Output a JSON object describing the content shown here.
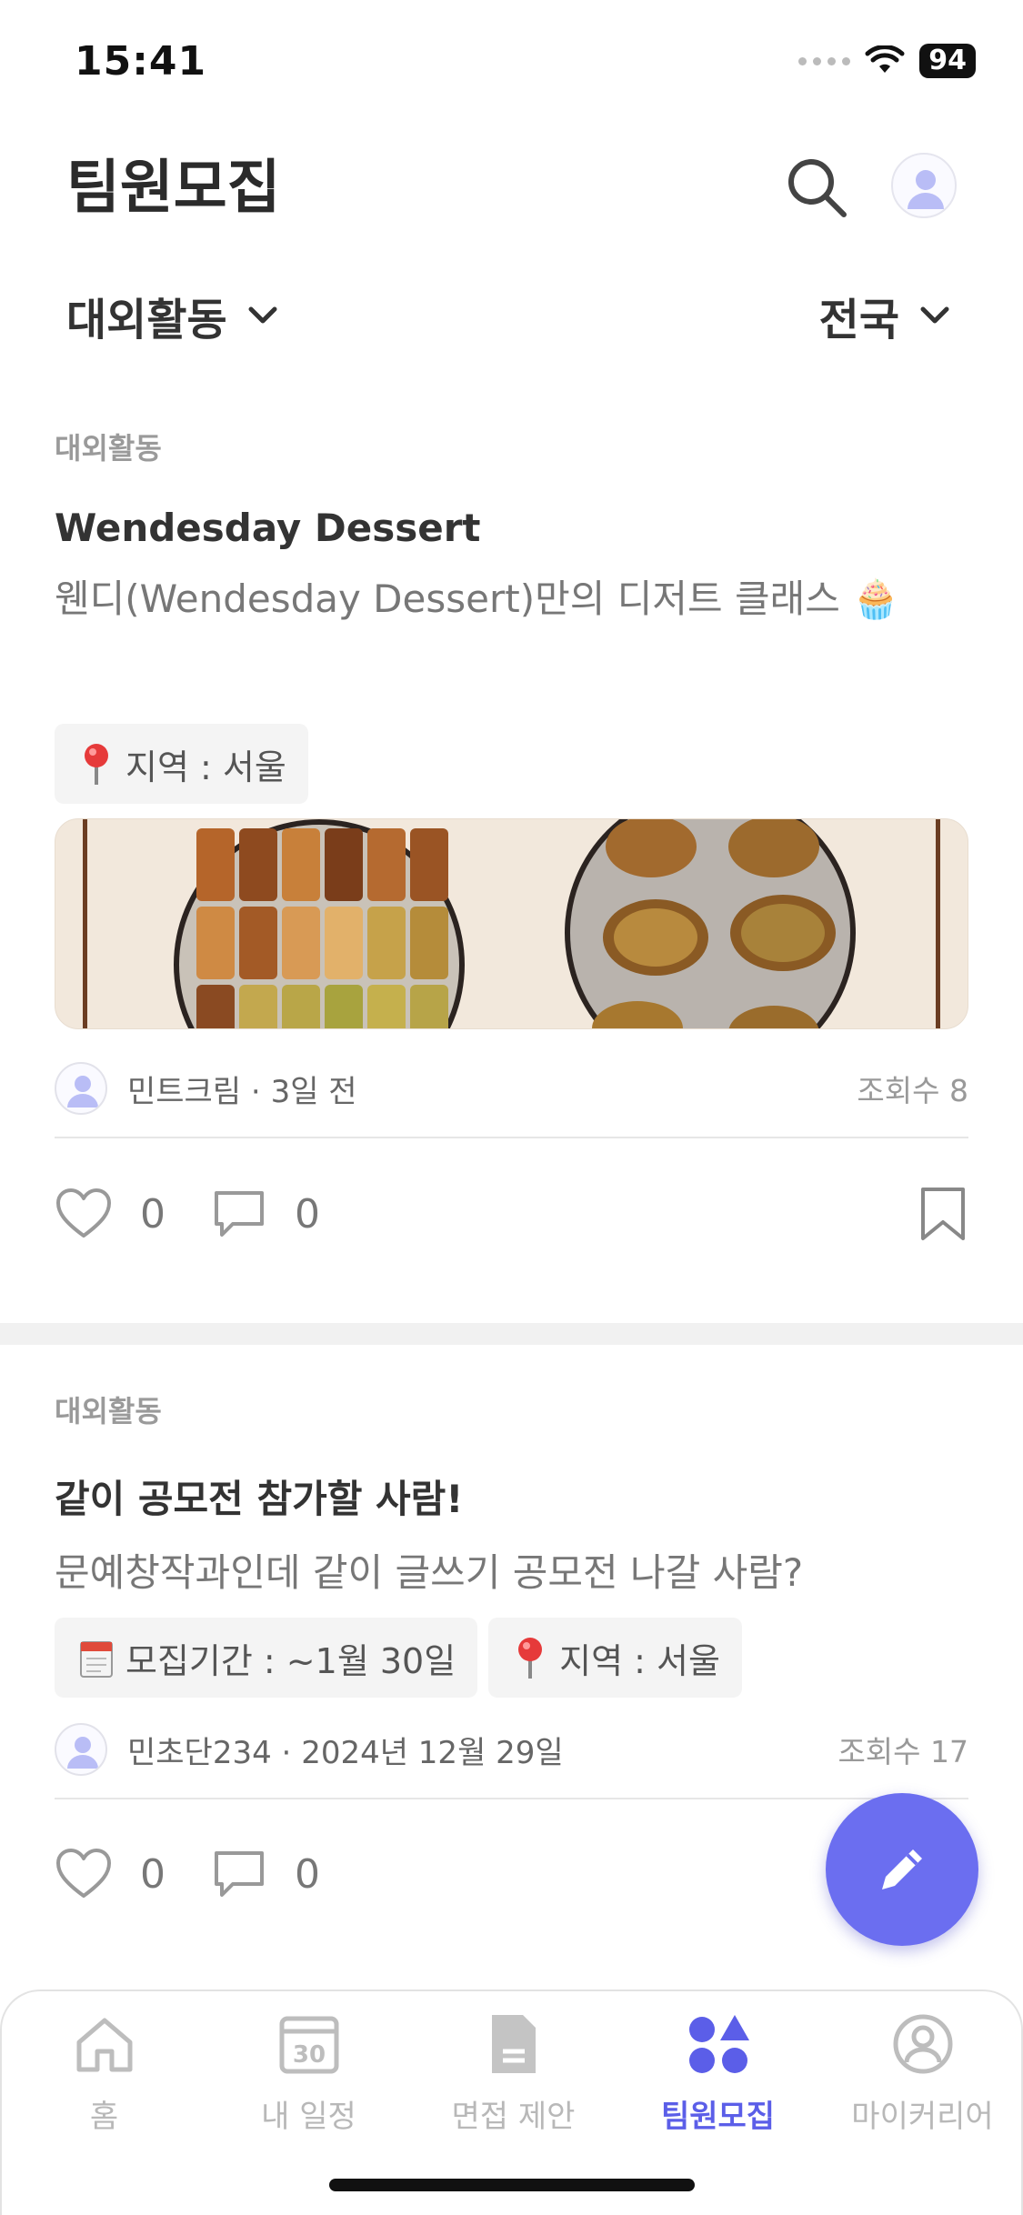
{
  "status_bar": {
    "time": "15:41",
    "battery": "94"
  },
  "header": {
    "title": "팀원모집"
  },
  "filters": {
    "category": "대외활동",
    "region": "전국"
  },
  "posts": [
    {
      "category": "대외활동",
      "title": "Wendesday Dessert",
      "description": "웬디(Wendesday Dessert)만의 디저트 클래스 🧁",
      "tags": [
        {
          "icon": "pin-icon",
          "text": "지역 : 서울"
        }
      ],
      "author": "민트크림",
      "time": "3일 전",
      "views": "조회수 8",
      "likes": "0",
      "comments": "0"
    },
    {
      "category": "대외활동",
      "title": "같이 공모전 참가할 사람!",
      "description": "문예창작과인데 같이 글쓰기 공모전 나갈 사람?",
      "tags": [
        {
          "icon": "calendar-icon",
          "text": "모집기간 : ~1월 30일"
        },
        {
          "icon": "pin-icon",
          "text": "지역 : 서울"
        }
      ],
      "author": "민초단234",
      "time": "2024년 12월 29일",
      "views": "조회수 17",
      "likes": "0",
      "comments": "0"
    }
  ],
  "separator": " · ",
  "tabbar": {
    "items": [
      {
        "label": "홈",
        "icon": "home-icon"
      },
      {
        "label": "내 일정",
        "icon": "calendar-icon",
        "icon_text": "30"
      },
      {
        "label": "면접 제안",
        "icon": "document-icon"
      },
      {
        "label": "팀원모집",
        "icon": "shapes-icon",
        "active": true
      },
      {
        "label": "마이커리어",
        "icon": "profile-icon"
      }
    ]
  },
  "colors": {
    "accent": "#5b5ee8",
    "fab": "#6b6ef0"
  }
}
